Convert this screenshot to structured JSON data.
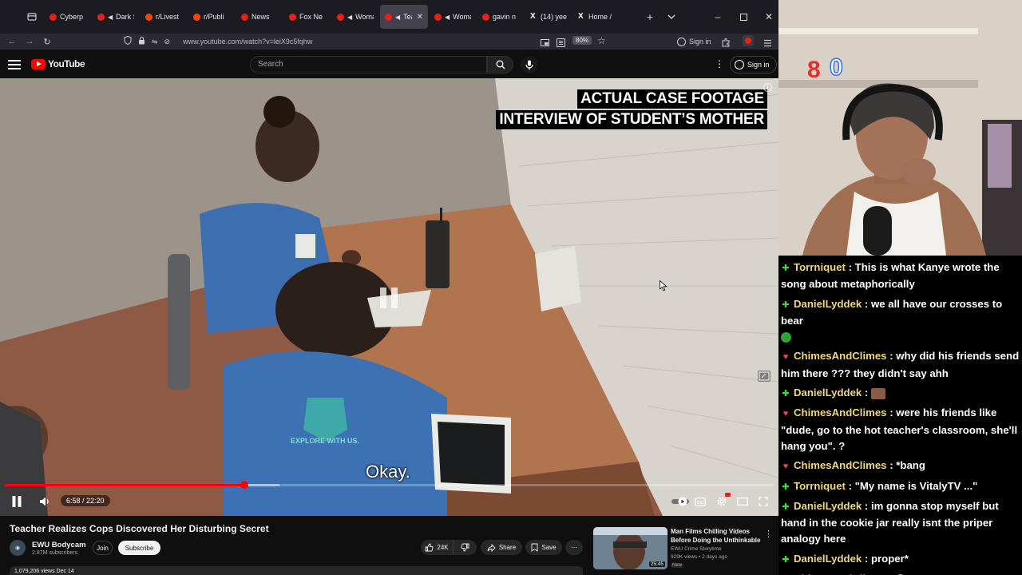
{
  "browser": {
    "tabs": [
      {
        "label": "Cyberp",
        "color": "#e62117",
        "sound": false,
        "active": false
      },
      {
        "label": "Dark S",
        "color": "#e62117",
        "sound": true,
        "active": false
      },
      {
        "label": "r/Livest",
        "color": "#ff4500",
        "sound": false,
        "active": false
      },
      {
        "label": "r/Publi",
        "color": "#ff4500",
        "sound": false,
        "active": false
      },
      {
        "label": "News",
        "color": "#e62117",
        "sound": false,
        "active": false
      },
      {
        "label": "Fox Ne",
        "color": "#e62117",
        "sound": false,
        "active": false
      },
      {
        "label": "Woma",
        "color": "#e62117",
        "sound": true,
        "active": false
      },
      {
        "label": "Tea",
        "color": "#e62117",
        "sound": true,
        "active": true
      },
      {
        "label": "Woma",
        "color": "#e62117",
        "sound": true,
        "active": false
      },
      {
        "label": "gavin n",
        "color": "#e62117",
        "sound": false,
        "active": false
      },
      {
        "label": "(14) yee",
        "color": "#ffffff",
        "sound": false,
        "active": false,
        "x": true
      },
      {
        "label": "Home /",
        "color": "#ffffff",
        "sound": false,
        "active": false,
        "x": true
      }
    ],
    "url": "www.youtube.com/watch?v=leiX9c5fqhw",
    "zoom": "80%",
    "signin_label": "Sign in"
  },
  "youtube": {
    "logo_text": "YouTube",
    "search_placeholder": "Search",
    "signin_label": "Sign in"
  },
  "video": {
    "caption_line1": "ACTUAL CASE FOOTAGE",
    "caption_line2": "INTERVIEW OF STUDENT’S MOTHER",
    "subtitle": "Okay.",
    "shirt_text": "EXPLORE WITH US.",
    "time": "6:58 / 22:20",
    "progress": 0.312,
    "buffered": 0.357
  },
  "watch": {
    "title": "Teacher Realizes Cops Discovered Her Disturbing Secret",
    "channel_name": "EWU Bodycam",
    "channel_subs": "2.87M subscribers",
    "join_label": "Join",
    "subscribe_label": "Subscribe",
    "likes": "24K",
    "share_label": "Share",
    "save_label": "Save",
    "views_line": "1,079,206 views  Dec 14"
  },
  "recommended": {
    "title": "Man Films Chilling Videos Before Doing the Unthinkable",
    "channel": "EWU Crime Storytime",
    "meta": "929K views • 2 days ago",
    "badge": "New",
    "duration": "25:45"
  },
  "stream": {
    "counter": "0"
  },
  "chat": [
    {
      "badge": "plus",
      "user": "Torrniquet",
      "text": " : This is what Kanye wrote the song about metaphorically"
    },
    {
      "badge": "plus",
      "user": "DanielLyddek",
      "text": " : we all have our crosses to bear",
      "emote": "green"
    },
    {
      "badge": "heart",
      "user": "ChimesAndClimes",
      "text": " : why did his friends send him there ??? they didn't say ahh"
    },
    {
      "badge": "plus",
      "user": "DanielLyddek",
      "text": " : ",
      "emote": "face"
    },
    {
      "badge": "heart",
      "user": "ChimesAndClimes",
      "text": " : were his friends like \"dude, go to the hot teacher's classroom, she'll hang you\". ?"
    },
    {
      "badge": "heart",
      "user": "ChimesAndClimes",
      "text": " : *bang"
    },
    {
      "badge": "plus",
      "user": "Torrniquet",
      "text": " : \"My name is VitalyTV ...\""
    },
    {
      "badge": "plus",
      "user": "DanielLyddek",
      "text": " : im gonna stop myself but hand in the cookie jar really isnt the priper analogy here"
    },
    {
      "badge": "plus",
      "user": "DanielLyddek",
      "text": " : proper*"
    },
    {
      "badge": "heart",
      "user": "ChimesAndClimes",
      "text": " : ",
      "emote": "shrug"
    }
  ],
  "colors": {
    "accent_red": "#ff0000",
    "chat_username": "#f0d97a",
    "chat_plus": "#3ddc3d",
    "chat_heart": "#e8475f"
  }
}
